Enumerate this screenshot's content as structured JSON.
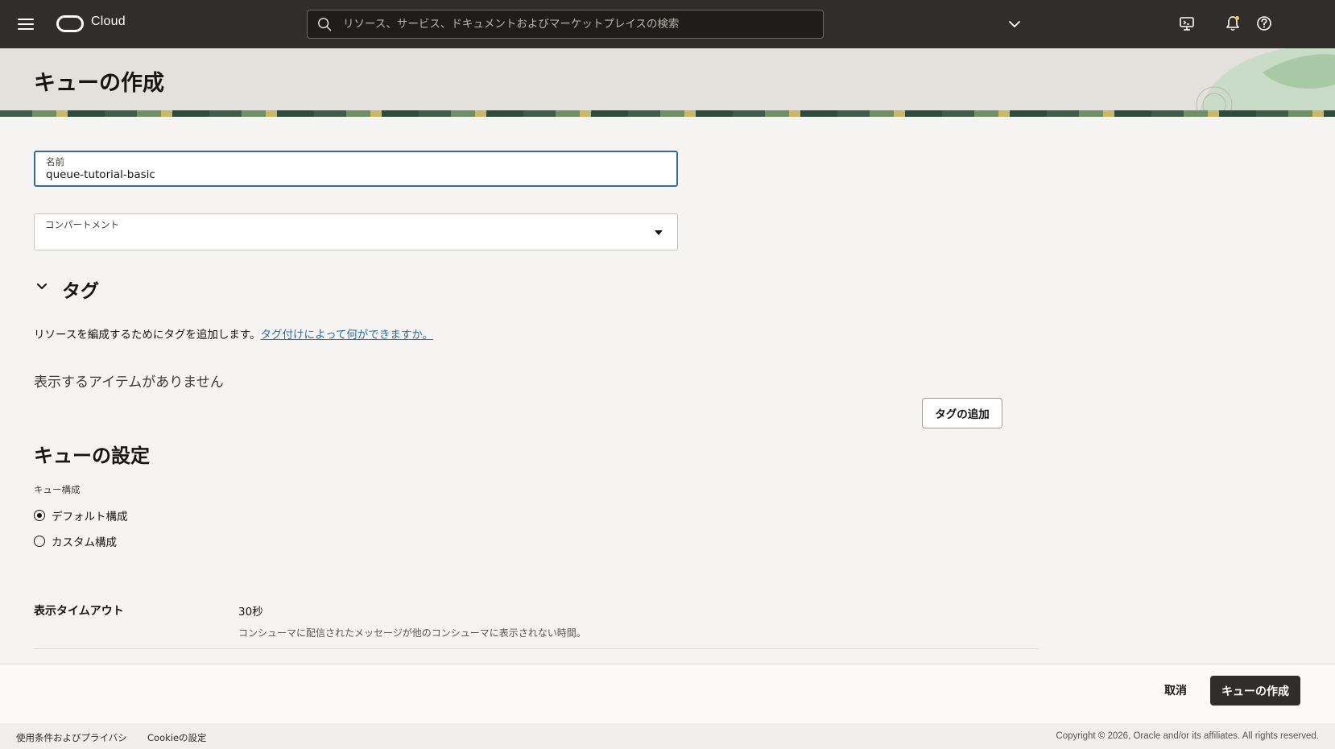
{
  "app": {
    "brand": "Cloud"
  },
  "search": {
    "placeholder": "リソース、サービス、ドキュメントおよびマーケットプレイスの検索"
  },
  "page": {
    "title": "キューの作成"
  },
  "form": {
    "name": {
      "label": "名前",
      "value": "queue-tutorial-basic"
    },
    "compartment": {
      "label": "コンパートメント",
      "value": ""
    }
  },
  "tags": {
    "title": "タグ",
    "description": "リソースを編成するためにタグを追加します。",
    "link": "タグ付けによって何ができますか。",
    "empty": "表示するアイテムがありません",
    "add_button": "タグの追加"
  },
  "settings": {
    "title": "キューの設定",
    "config_label": "キュー構成",
    "options": [
      {
        "label": "デフォルト構成",
        "checked": true
      },
      {
        "label": "カスタム構成",
        "checked": false
      }
    ],
    "visibility_timeout": {
      "label": "表示タイムアウト",
      "value": "30秒",
      "help": "コンシューマに配信されたメッセージが他のコンシューマに表示されない時間。"
    }
  },
  "actions": {
    "cancel": "取消",
    "create": "キューの作成"
  },
  "footer": {
    "terms": "使用条件およびプライバシ",
    "cookies": "Cookieの設定",
    "copyright": "Copyright © 2026, Oracle and/or its affiliates. All rights reserved."
  },
  "icons": {
    "menu": "hamburger-menu-icon",
    "search": "search-icon",
    "region": "chevron-down-icon",
    "cloud_shell": "cloud-shell-icon",
    "notifications": "bell-icon",
    "help": "help-icon"
  },
  "colors": {
    "topbar": "#312d2a",
    "link": "#2e6ea6",
    "primary_button": "#312d2a",
    "focus_border": "#3a6b98"
  }
}
